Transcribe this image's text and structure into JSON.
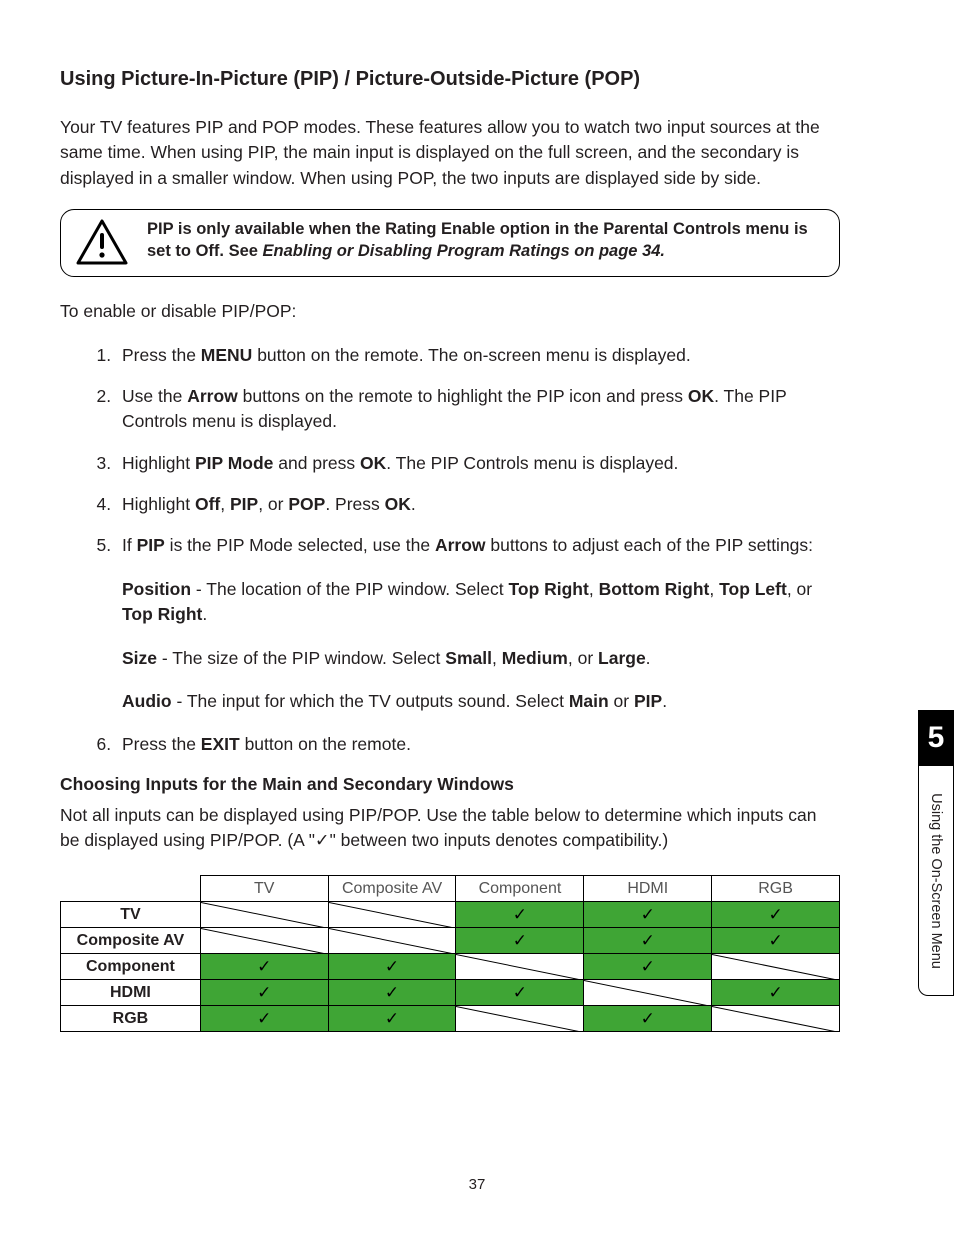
{
  "heading": "Using Picture-In-Picture (PIP) / Picture-Outside-Picture (POP)",
  "intro": "Your TV features PIP and POP modes. These features allow you to watch two input sources at the same time. When using PIP, the main input is displayed on the full screen, and the secondary is displayed in a smaller window. When using POP, the two inputs are displayed side by side.",
  "callout": {
    "line1": "PIP is only available when the Rating Enable option in the Parental Controls menu is set to Off. See ",
    "line2": "Enabling or Disabling Program Ratings on page 34."
  },
  "lead": "To enable or disable PIP/POP:",
  "steps": {
    "s1_a": "Press the ",
    "s1_b": "MENU",
    "s1_c": " button on the remote. The on-screen menu is displayed.",
    "s2_a": "Use the ",
    "s2_b": "Arrow",
    "s2_c": " buttons on the remote to highlight the PIP icon and press ",
    "s2_d": "OK",
    "s2_e": ". The PIP Controls menu is displayed.",
    "s3_a": "Highlight ",
    "s3_b": "PIP Mode",
    "s3_c": " and press ",
    "s3_d": "OK",
    "s3_e": ". The PIP Controls menu is displayed.",
    "s4_a": "Highlight ",
    "s4_b": "Off",
    "s4_c": ", ",
    "s4_d": "PIP",
    "s4_e": ", or ",
    "s4_f": "POP",
    "s4_g": ". Press ",
    "s4_h": "OK",
    "s4_i": ".",
    "s5_a": "If ",
    "s5_b": "PIP",
    "s5_c": " is the PIP Mode selected, use the ",
    "s5_d": "Arrow",
    "s5_e": " buttons to adjust each of the PIP settings:",
    "pos_lbl": "Position",
    "pos_txt": " - The location of the PIP window. Select ",
    "pos_o1": "Top Right",
    "pos_o2": "Bottom Right",
    "pos_o3": "Top Left",
    "pos_o4": "Top Right",
    "size_lbl": "Size",
    "size_txt": " - The size of the PIP window. Select ",
    "size_o1": "Small",
    "size_o2": "Medium",
    "size_o3": "Large",
    "aud_lbl": "Audio",
    "aud_txt": " - The input for which the TV outputs sound. Select ",
    "aud_o1": "Main",
    "aud_o2": "PIP",
    "s6_a": "Press the ",
    "s6_b": "EXIT",
    "s6_c": " button on the remote."
  },
  "subhead": "Choosing Inputs for the Main and Secondary Windows",
  "subtext": "Not all inputs can be displayed using PIP/POP. Use the table below to determine which inputs can be displayed using PIP/POP. (A \"✓\" between two inputs denotes compatibility.)",
  "table": {
    "cols": [
      "TV",
      "Composite AV",
      "Component",
      "HDMI",
      "RGB"
    ],
    "rows": [
      "TV",
      "Composite AV",
      "Component",
      "HDMI",
      "RGB"
    ],
    "cells": [
      [
        "diag",
        "diag",
        "chk",
        "chk",
        "chk"
      ],
      [
        "diag",
        "diag",
        "chk",
        "chk",
        "chk"
      ],
      [
        "chk",
        "chk",
        "diag",
        "chk",
        "diag"
      ],
      [
        "chk",
        "chk",
        "chk",
        "diag",
        "chk"
      ],
      [
        "chk",
        "chk",
        "diag",
        "chk",
        "diag"
      ]
    ]
  },
  "sidetab": {
    "num": "5",
    "label": "Using the On-Screen Menu"
  },
  "pagenum": "37"
}
